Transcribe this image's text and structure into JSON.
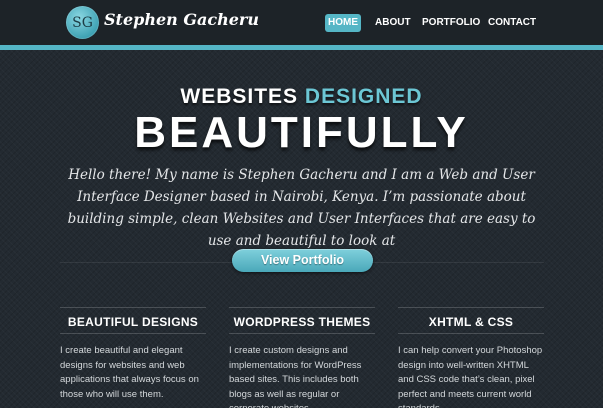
{
  "brand": {
    "logo_text": "SG",
    "name": "Stephen Gacheru"
  },
  "nav": {
    "items": [
      {
        "label": "HOME",
        "active": true
      },
      {
        "label": "ABOUT",
        "active": false
      },
      {
        "label": "PORTFOLIO",
        "active": false
      },
      {
        "label": "CONTACT",
        "active": false
      }
    ]
  },
  "hero": {
    "line1_part1": "WEBSITES ",
    "line1_part2": "DESIGNED",
    "line2": "BEAUTIFULLY",
    "intro": "Hello there! My name is Stephen Gacheru and I am a Web and User Interface Designer based in Nairobi, Kenya. I’m passionate about building simple, clean Websites and User Interfaces that are easy to use and beautiful to look at",
    "cta_label": "View Portfolio"
  },
  "features": [
    {
      "title": "BEAUTIFUL DESIGNS",
      "text": "I create beautiful and elegant designs for websites and web applications that always focus on those who will use them."
    },
    {
      "title": "WORDPRESS THEMES",
      "text": "I create custom designs and implementations for WordPress based sites. This includes both blogs as well as regular or corporate websites."
    },
    {
      "title": "XHTML & CSS",
      "text": "I can help convert your Photoshop design into well-written XHTML and CSS code that’s clean, pixel perfect and meets current world standards."
    }
  ],
  "colors": {
    "accent": "#55b6c6",
    "background": "#232a31",
    "header": "#1d2328"
  }
}
